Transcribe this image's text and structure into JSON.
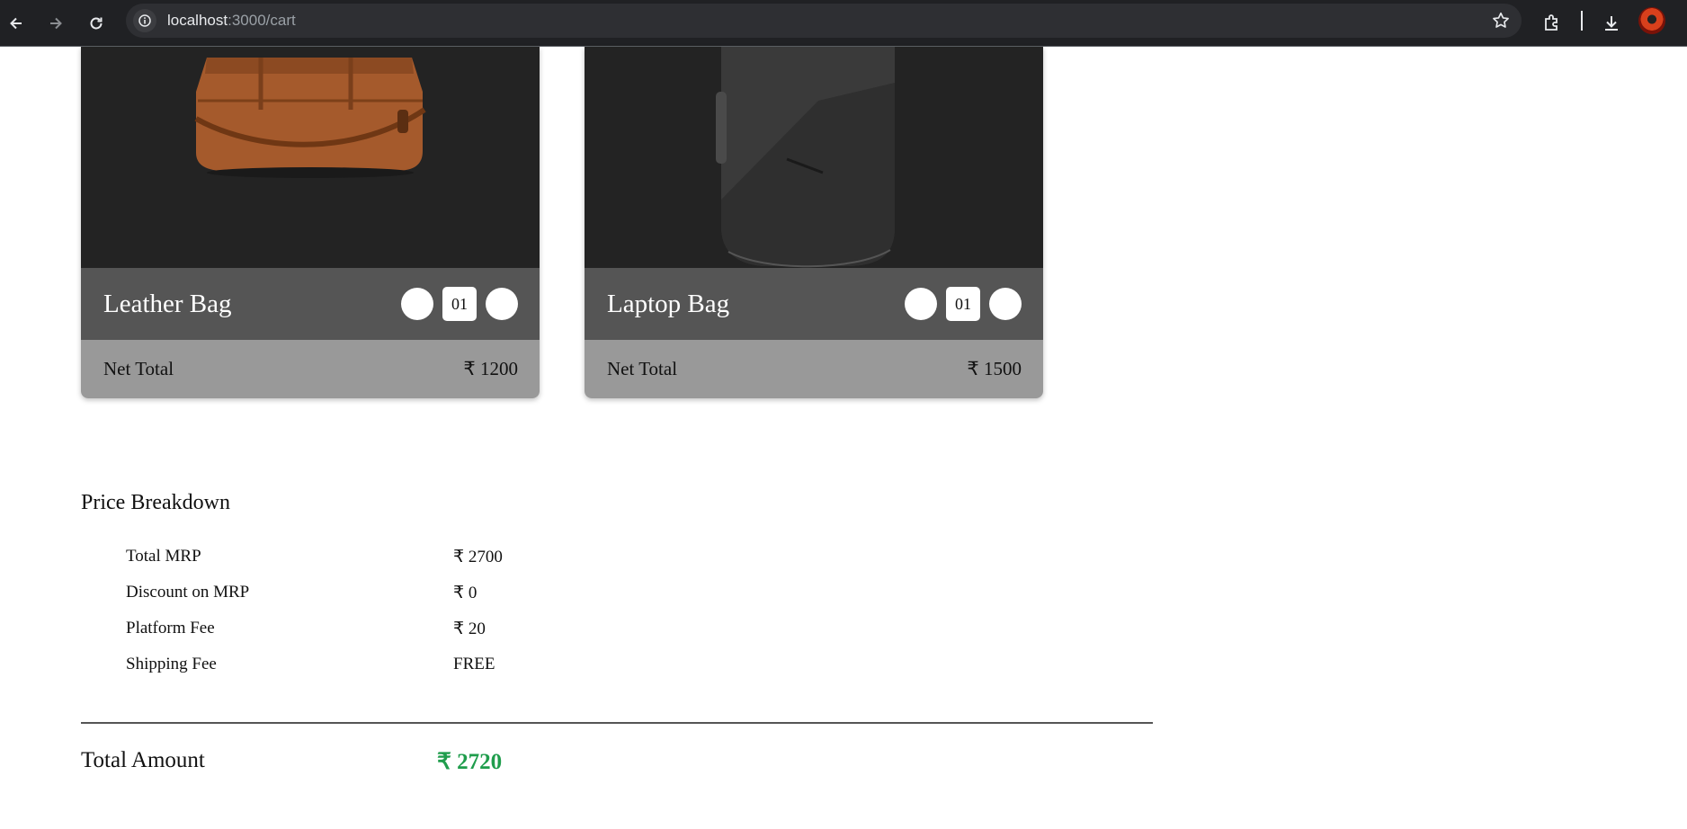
{
  "browser": {
    "url_host": "localhost",
    "url_path": ":3000/cart"
  },
  "cart": {
    "items": [
      {
        "name": "Leather Bag",
        "quantity": "01",
        "net_total_label": "Net Total",
        "net_total": "₹ 1200"
      },
      {
        "name": "Laptop Bag",
        "quantity": "01",
        "net_total_label": "Net Total",
        "net_total": "₹ 1500"
      }
    ]
  },
  "price_breakdown": {
    "title": "Price Breakdown",
    "rows": [
      {
        "label": "Total MRP",
        "value": "₹ 2700"
      },
      {
        "label": "Discount on MRP",
        "value": "₹ 0"
      },
      {
        "label": "Platform Fee",
        "value": "₹ 20"
      },
      {
        "label": "Shipping Fee",
        "value": "FREE"
      }
    ]
  },
  "total": {
    "label": "Total Amount",
    "value": "₹ 2720"
  },
  "colors": {
    "total_value": "#1f9d4c",
    "card_image_bg": "#232323",
    "card_header_bg": "#555555",
    "card_footer_bg": "#999999"
  }
}
